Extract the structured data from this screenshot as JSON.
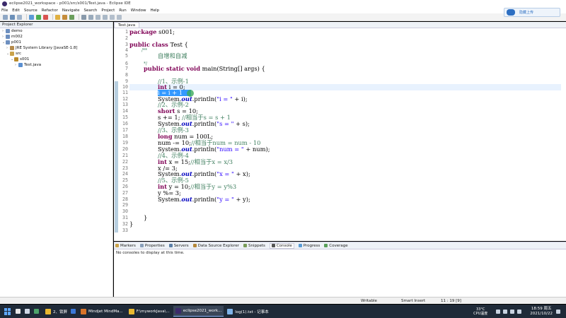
{
  "window": {
    "title": "eclipse2021_workspace - p001/src/s001/Test.java - Eclipse IDE",
    "menu": [
      "File",
      "Edit",
      "Source",
      "Refactor",
      "Navigate",
      "Search",
      "Project",
      "Run",
      "Window",
      "Help"
    ],
    "cloud_button_label": "隐藏上传"
  },
  "project_explorer": {
    "title": "Project Explorer",
    "items": [
      {
        "label": "demo"
      },
      {
        "label": "m002"
      },
      {
        "label": "p001"
      },
      {
        "label": "JRE System Library [JavaSE-1.8]"
      },
      {
        "label": "src"
      },
      {
        "label": "s001"
      },
      {
        "label": "Test.java"
      }
    ]
  },
  "editor": {
    "tab_label": "Test.java",
    "line_numbers": [
      "1",
      "2",
      "3",
      "4",
      "5",
      "6",
      "7",
      "8",
      "9",
      "10",
      "11",
      "12",
      "13",
      "14",
      "15",
      "16",
      "17",
      "18",
      "19",
      "20",
      "21",
      "22",
      "23",
      "24",
      "25",
      "26",
      "27",
      "28",
      "29",
      "30",
      "31",
      "32",
      "33"
    ],
    "lines": {
      "l1_kw": "package",
      "l1_rest": " s001;",
      "l3_kw": "public class",
      "l3_rest": " Test {",
      "l4": "/**",
      "l5": "自增和自减",
      "l6": "*/",
      "l7_kw": "public static void",
      "l7_rest": " main(String[] args) {",
      "l9": "//1、示例-1",
      "l10_kw": "int",
      "l10_rest": " i = 0;",
      "l11": "i = i + 1",
      "l12_a": "System.",
      "l12_field": "out",
      "l12_b": ".println(",
      "l12_str": "\"i = \"",
      "l12_c": " + i);",
      "l13": "//2、示例-2",
      "l14_kw": "short",
      "l14_rest": " s = 10;",
      "l15_a": "s += 1; ",
      "l15_cm": "//相当于s = s + 1",
      "l16_a": "System.",
      "l16_field": "out",
      "l16_b": ".println(",
      "l16_str": "\"s = \"",
      "l16_c": " + s);",
      "l17": "//3、示例-3",
      "l18_kw": "long",
      "l18_rest": " num = 100L;",
      "l19_a": "num -= 10;",
      "l19_cm": "//相当于num = num - 10",
      "l20_a": "System.",
      "l20_field": "out",
      "l20_b": ".println(",
      "l20_str": "\"num = \"",
      "l20_c": " + num);",
      "l21": "//4、示例-4",
      "l22_kw": "int",
      "l22_rest": " x = 15;",
      "l22_cm": "//相当于x = x/3",
      "l23": "x /= 3;",
      "l24_a": "System.",
      "l24_field": "out",
      "l24_b": ".println(",
      "l24_str": "\"x = \"",
      "l24_c": " + x);",
      "l25": "//5、示例-5",
      "l26_kw": "int",
      "l26_rest": " y = 10;",
      "l26_cm": "//相当于y = y%3",
      "l27": "y %= 3;",
      "l28_a": "System.",
      "l28_field": "out",
      "l28_b": ".println(",
      "l28_str": "\"y = \"",
      "l28_c": " + y);",
      "l31": "}",
      "l32": "}"
    }
  },
  "console": {
    "tabs": [
      "Markers",
      "Properties",
      "Servers",
      "Data Source Explorer",
      "Snippets",
      "Console",
      "Progress",
      "Coverage"
    ],
    "active_tab": "Console",
    "message": "No consoles to display at this time."
  },
  "status_bar": {
    "writable": "Writable",
    "insert_mode": "Smart Insert",
    "position": "11 : 19 [9]"
  },
  "taskbar": {
    "tasks": [
      {
        "label": "2、锁屏"
      },
      {
        "label": "Mindjet MindMa..."
      },
      {
        "label": "F:\\myworkJava\\..."
      },
      {
        "label": "eclipse2021_work..."
      },
      {
        "label": "log(1).txt - 记事本"
      }
    ],
    "weather_temp": "33°C",
    "weather_desc": "CPU温度",
    "time": "18:59 周五",
    "date": "2021/10/22"
  },
  "colors": {
    "keyword": "#7f0055",
    "comment": "#3f7f5f",
    "string": "#2a00ff",
    "field": "#0000c0",
    "selection": "#3399ff",
    "taskbar_bg": "#1f2a38"
  }
}
